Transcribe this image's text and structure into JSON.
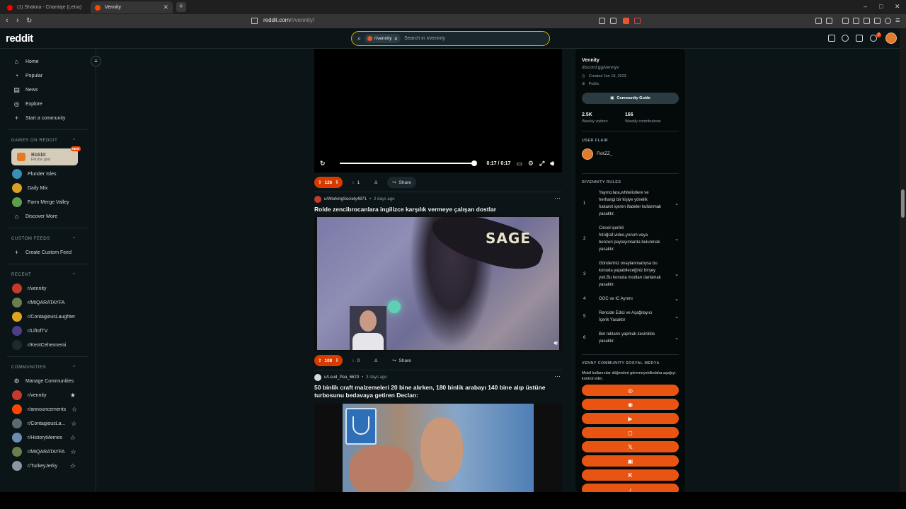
{
  "browser": {
    "tabs": [
      {
        "title": "(1) Shakira - Chantaje (Letra) ft. Mal...",
        "active": false,
        "favicon_color": "#ff0000"
      },
      {
        "title": "Vennity",
        "active": true,
        "favicon_color": "#ff4500"
      }
    ],
    "url_host": "reddit.com",
    "url_path": "/r/vennity/",
    "window_controls": [
      "–",
      "□",
      "✕"
    ]
  },
  "header": {
    "logo": "reddit",
    "search_chip": "r/vennity",
    "search_placeholder": "Search in r/vennity",
    "notification_count": "2"
  },
  "leftnav": {
    "main": [
      {
        "label": "Home",
        "icon": "home-icon",
        "glyph": "⌂"
      },
      {
        "label": "Popular",
        "icon": "popular-icon",
        "glyph": "◔"
      },
      {
        "label": "News",
        "icon": "news-icon",
        "glyph": "▤"
      },
      {
        "label": "Explore",
        "icon": "explore-icon",
        "glyph": "◎"
      },
      {
        "label": "Start a community",
        "icon": "plus-icon",
        "glyph": "+"
      }
    ],
    "games_header": "GAMES ON REDDIT",
    "blokkit": {
      "title": "Blokkit",
      "subtitle": "Fill the grid",
      "badge": "NEW"
    },
    "games": [
      {
        "label": "Plunder Isles",
        "color": "#3a8fb6"
      },
      {
        "label": "Daily Mix",
        "color": "#d9a024"
      },
      {
        "label": "Farm Merge Valley",
        "color": "#5e9e4a"
      },
      {
        "label": "Discover More",
        "glyph": "⌂"
      }
    ],
    "custom_header": "CUSTOM FEEDS",
    "create_feed": "Create Custom Feed",
    "recent_header": "RECENT",
    "recent": [
      {
        "label": "r/vennity",
        "color": "#c43b2b"
      },
      {
        "label": "r/MIQARATAYFA",
        "color": "#6a7f4c"
      },
      {
        "label": "r/ContagiousLaughter",
        "color": "#e0a51c"
      },
      {
        "label": "r/LiftofTV",
        "color": "#4b3f8a"
      },
      {
        "label": "r/KentCehennemi",
        "color": "#1e2a30"
      }
    ],
    "communities_header": "COMMUNITIES",
    "manage": "Manage Communities",
    "communities": [
      {
        "label": "r/vennity",
        "color": "#c43b2b",
        "starred": true
      },
      {
        "label": "r/announcements",
        "color": "#ff4500",
        "starred": false
      },
      {
        "label": "r/ContagiousLa...",
        "color": "#5a6a72",
        "starred": false
      },
      {
        "label": "r/HistoryMemes",
        "color": "#6b8cb0",
        "starred": false
      },
      {
        "label": "r/MIQARATAYFA",
        "color": "#6a7f4c",
        "starred": false
      },
      {
        "label": "r/TurkeyJerky",
        "color": "#8a96a4",
        "starred": false
      }
    ]
  },
  "feed": {
    "post1": {
      "time": "0:17 / 0:17",
      "video_progress": 1.0,
      "votes": "126",
      "comments": "1",
      "share": "Share"
    },
    "post2": {
      "author": "u/WorkingSociety4871",
      "age": "2 days ago",
      "title": "Rolde zencibrocanlara ingilizce karşılık vermeye çalışan dostlar",
      "image_text": "SAGE",
      "votes": "108",
      "comments": "0",
      "share": "Share"
    },
    "post3": {
      "author": "u/Loud_Pea_6620",
      "age": "3 days ago",
      "title": "50 binlik craft malzemeleri 20 bine alırken, 180 binlik arabayı 140 bine alıp üstüne turbosunu bedavaya getiren Declan:"
    }
  },
  "sidebar": {
    "name": "Vennity",
    "link": "discord.gg/vennyv",
    "created": "Created Jun 18, 2023",
    "visibility": "Public",
    "guide_label": "Community Guide",
    "visitors_value": "2.5K",
    "visitors_label": "Weekly visitors",
    "contrib_value": "166",
    "contrib_label": "Weekly contributions",
    "flair_header": "USER FLAIR",
    "flair_user": "FlokZZ_",
    "rules_header": "R/VENNITY RULES",
    "rules": [
      {
        "num": "1",
        "text": "Yayıncılara,whitelistlere ve herhangi bir kişiye yönelik hakaret içeren ifadeler kullanmak yasaktır."
      },
      {
        "num": "2",
        "text": "Cinsel içerikli fotoğraf,video,yorum veya benzeri paylaşımlarda bulunmak yasaktır."
      },
      {
        "num": "3",
        "text": "Gönderiniz onaylanmadıysa bu konuda yapabileceğiniz birşey yok.Bu konuda modları darlamak yasaktır."
      },
      {
        "num": "4",
        "text": "OOC ve IC Ayrımı"
      },
      {
        "num": "5",
        "text": "Rencide Edici ve Aşağılayıcı İçerik Yasaktır"
      },
      {
        "num": "6",
        "text": "Bet reklamı yapmak kesinlikle yasaktır."
      }
    ],
    "social_header": "VENNY COMMUNITY SOSYAL MEDYA",
    "social_desc": "Mobil kullanıcılar düğmeleri göremeyebilirdaha aşağıyı kontrol edin.",
    "social_buttons": [
      {
        "name": "website-icon",
        "glyph": "◎"
      },
      {
        "name": "discord-icon",
        "glyph": "◉"
      },
      {
        "name": "youtube-icon",
        "glyph": "▶"
      },
      {
        "name": "instagram-icon",
        "glyph": "◻"
      },
      {
        "name": "x-icon",
        "glyph": "𝕏"
      },
      {
        "name": "twitch-icon",
        "glyph": "▣"
      },
      {
        "name": "kick-icon",
        "glyph": "K"
      },
      {
        "name": "tiktok-icon",
        "glyph": "♪"
      }
    ]
  }
}
